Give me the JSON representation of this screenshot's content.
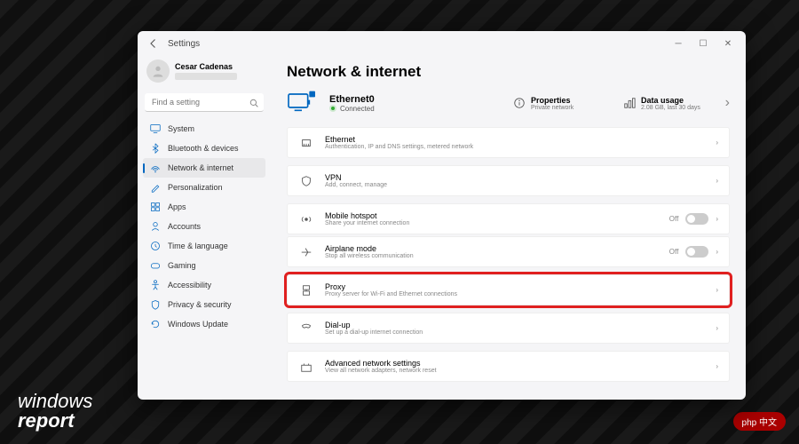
{
  "titlebar": {
    "title": "Settings"
  },
  "user": {
    "name": "Cesar Cadenas"
  },
  "search": {
    "placeholder": "Find a setting"
  },
  "sidebar": {
    "items": [
      {
        "label": "System"
      },
      {
        "label": "Bluetooth & devices"
      },
      {
        "label": "Network & internet"
      },
      {
        "label": "Personalization"
      },
      {
        "label": "Apps"
      },
      {
        "label": "Accounts"
      },
      {
        "label": "Time & language"
      },
      {
        "label": "Gaming"
      },
      {
        "label": "Accessibility"
      },
      {
        "label": "Privacy & security"
      },
      {
        "label": "Windows Update"
      }
    ]
  },
  "page": {
    "title": "Network & internet",
    "adapter": "Ethernet0",
    "status": "Connected",
    "props": {
      "label": "Properties",
      "sub": "Private network"
    },
    "usage": {
      "label": "Data usage",
      "sub": "2.08 GB, last 30 days"
    },
    "cards": [
      {
        "title": "Ethernet",
        "sub": "Authentication, IP and DNS settings, metered network"
      },
      {
        "title": "VPN",
        "sub": "Add, connect, manage"
      },
      {
        "title": "Mobile hotspot",
        "sub": "Share your internet connection",
        "toggle": "Off"
      },
      {
        "title": "Airplane mode",
        "sub": "Stop all wireless communication",
        "toggle": "Off"
      },
      {
        "title": "Proxy",
        "sub": "Proxy server for Wi-Fi and Ethernet connections"
      },
      {
        "title": "Dial-up",
        "sub": "Set up a dial-up internet connection"
      },
      {
        "title": "Advanced network settings",
        "sub": "View all network adapters, network reset"
      }
    ]
  },
  "watermark": {
    "left1": "windows",
    "left2": "report",
    "right": "php 中文"
  }
}
